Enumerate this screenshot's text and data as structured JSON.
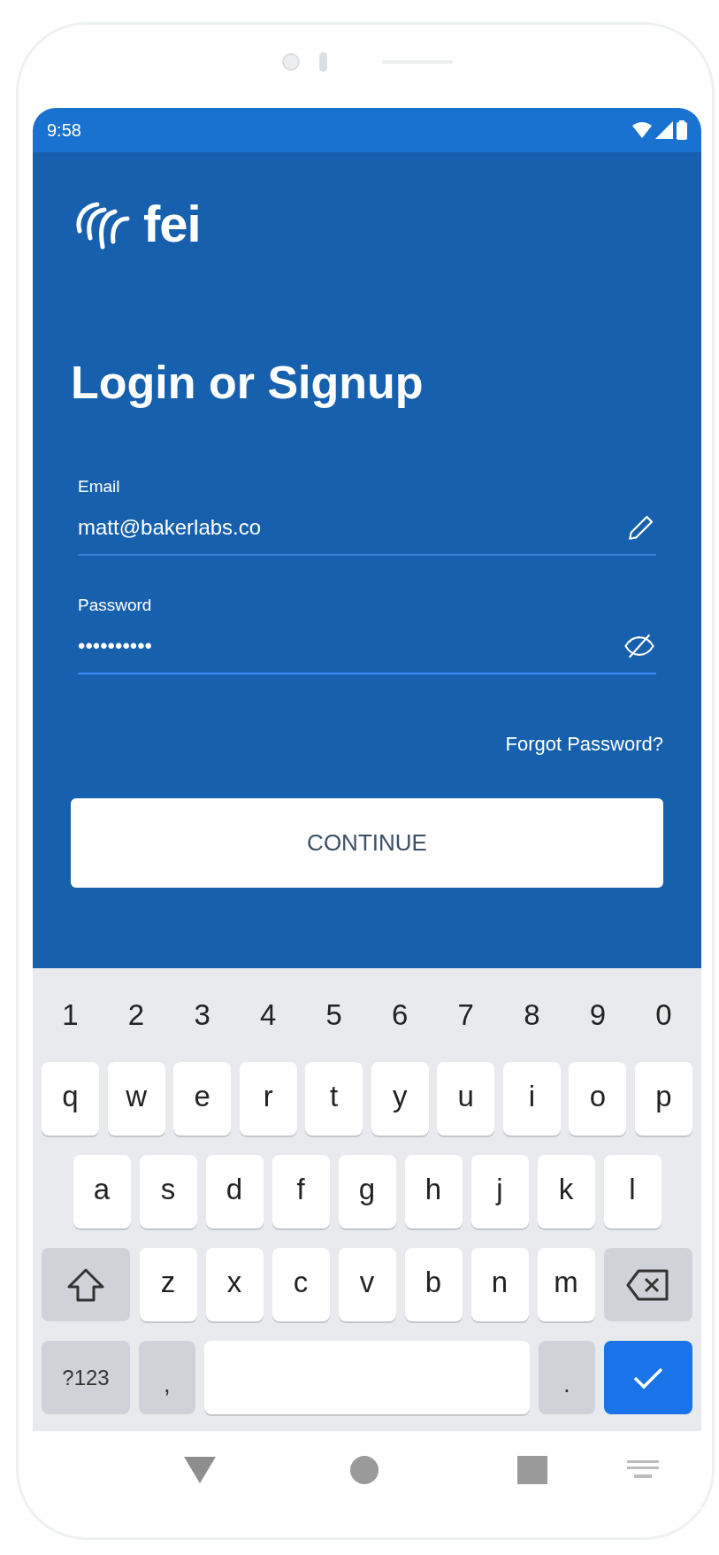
{
  "status_bar": {
    "time": "9:58"
  },
  "logo": {
    "text": "fei"
  },
  "title": "Login or Signup",
  "fields": [
    {
      "label": "Email",
      "value": "matt@bakerlabs.co",
      "kind": "edit",
      "focused": false
    },
    {
      "label": "Password",
      "value": "••••••••••",
      "kind": "visibility",
      "focused": true
    }
  ],
  "forgot_link": "Forgot Password?",
  "continue_button": "CONTINUE",
  "keyboard": {
    "number_row": [
      "1",
      "2",
      "3",
      "4",
      "5",
      "6",
      "7",
      "8",
      "9",
      "0"
    ],
    "rows": [
      [
        "q",
        "w",
        "e",
        "r",
        "t",
        "y",
        "u",
        "i",
        "o",
        "p"
      ],
      [
        "a",
        "s",
        "d",
        "f",
        "g",
        "h",
        "j",
        "k",
        "l"
      ],
      [
        "z",
        "x",
        "c",
        "v",
        "b",
        "n",
        "m"
      ]
    ],
    "symbols_key": "?123",
    "comma_key": ",",
    "period_key": "."
  }
}
